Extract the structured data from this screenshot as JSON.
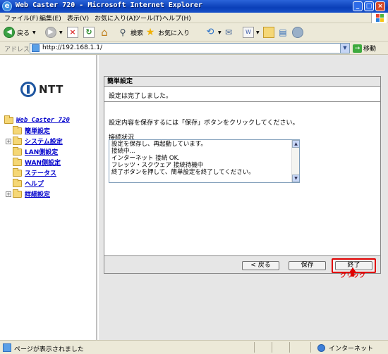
{
  "window": {
    "title": "Web Caster 720 - Microsoft Internet Explorer",
    "buttons": {
      "minimize": "_",
      "maximize": "□",
      "close": "×"
    }
  },
  "menubar": {
    "items": [
      {
        "label": "ファイル(F)"
      },
      {
        "label": "編集(E)"
      },
      {
        "label": "表示(V)"
      },
      {
        "label": "お気に入り(A)"
      },
      {
        "label": "ツール(T)"
      },
      {
        "label": "ヘルプ(H)"
      }
    ]
  },
  "toolbar": {
    "back_label": "戻る",
    "search_label": "検索",
    "favorites_label": "お気に入り"
  },
  "address": {
    "label": "アドレス(D)",
    "url": "http://192.168.1.1/",
    "go_label": "移動"
  },
  "sidebar": {
    "logo_text": "NTT",
    "root_label": "Web Caster 720",
    "items": [
      {
        "label": "簡単設定",
        "expandable": false
      },
      {
        "label": "システム設定",
        "expandable": true
      },
      {
        "label": "LAN側設定",
        "expandable": false
      },
      {
        "label": "WAN側設定",
        "expandable": false
      },
      {
        "label": "ステータス",
        "expandable": false
      },
      {
        "label": "ヘルプ",
        "expandable": false
      },
      {
        "label": "詳細設定",
        "expandable": true
      }
    ]
  },
  "panel": {
    "heading": "簡単設定",
    "message": "設定は完了しました。",
    "instruction": "設定内容を保存するには「保存」ボタンをクリックしてください。",
    "status_label": "接続状況",
    "status_lines": [
      "設定を保存し、再起動しています。",
      "接続中...",
      "インターネット 接続 OK.",
      "フレッツ・スクウェア 接続待機中",
      "終了ボタンを押して、簡単設定を終了してください。"
    ]
  },
  "buttons": {
    "back_label": "< 戻る",
    "save_label": "保存",
    "finish_label": "終了"
  },
  "annotation": {
    "click_label": "クリック",
    "color": "#e00000"
  },
  "statusbar": {
    "text": "ページが表示されました",
    "zone": "インターネット"
  }
}
